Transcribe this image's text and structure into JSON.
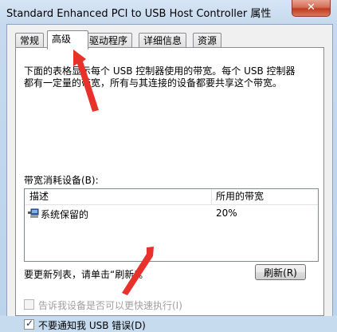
{
  "window": {
    "title": "Standard Enhanced PCI to USB Host Controller 属性",
    "close_glyph": "✕"
  },
  "tabs": [
    {
      "label": "常规",
      "active": false
    },
    {
      "label": "高级",
      "active": true
    },
    {
      "label": "驱动程序",
      "active": false
    },
    {
      "label": "详细信息",
      "active": false
    },
    {
      "label": "资源",
      "active": false
    }
  ],
  "advanced": {
    "description_line1": "下面的表格显示每个 USB 控制器使用的带宽。每个 USB 控制器",
    "description_line2": "都有一定量的带宽，所有与其连接的设备都要共享这个带宽。",
    "bandwidth_label": "带宽消耗设备(B):",
    "list": {
      "columns": [
        "描述",
        "所用的带宽"
      ],
      "rows": [
        {
          "icon": "usb-controller-icon",
          "name": "系统保留的",
          "bandwidth": "20%"
        }
      ]
    },
    "refresh_hint": "要更新列表，请单击“刷新”。",
    "refresh_button": "刷新(R)",
    "checkbox_fast": {
      "label": "告诉我设备是否可以更快速执行(I)",
      "checked": false,
      "disabled": true
    },
    "checkbox_usb_errors": {
      "label": "不要通知我 USB 错误(D)",
      "checked": true,
      "disabled": false
    }
  },
  "annotations": {
    "arrow_color": "#e8312a"
  }
}
